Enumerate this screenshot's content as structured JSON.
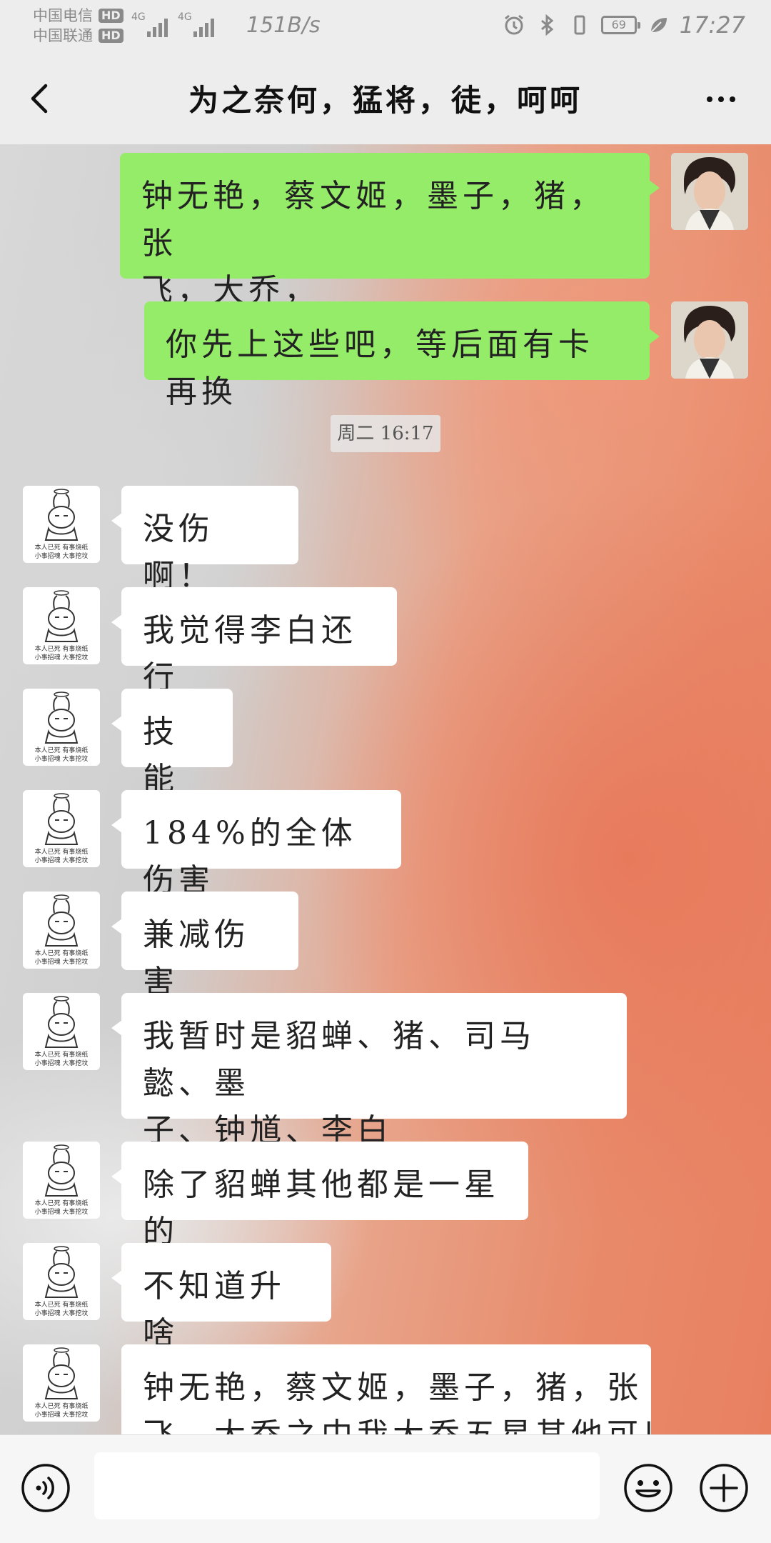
{
  "status_bar": {
    "carrier1": "中国电信",
    "carrier2": "中国联通",
    "hd": "HD",
    "net1": "4G",
    "net2": "4G",
    "speed": "151B/s",
    "battery": "69",
    "time": "17:27"
  },
  "header": {
    "title": "为之奈何，猛将，徒，呵呵"
  },
  "timestamp": "周二 16:17",
  "avatar_caption_line1": "本人已死 有事烧纸",
  "avatar_caption_line2": "小事招魂 大事挖坟",
  "messages_out": [
    {
      "line1": "钟无艳，蔡文姬，墨子，猪，张",
      "line2": "飞，大乔，"
    },
    {
      "line1": "你先上这些吧，等后面有卡再换"
    }
  ],
  "messages_in": [
    {
      "line1": "没伤啊！"
    },
    {
      "line1": "我觉得李白还行"
    },
    {
      "line1": "技能"
    },
    {
      "line1": "184%的全体伤害"
    },
    {
      "line1": "兼减伤害"
    },
    {
      "line1": "我暂时是貂蝉、猪、司马懿、墨",
      "line2": "子、钟馗、李白"
    },
    {
      "line1": "除了貂蝉其他都是一星的"
    },
    {
      "line1": "不知道升啥"
    },
    {
      "line1": "钟无艳，蔡文姬，墨子，猪，张",
      "line2": "飞，大乔之中我大乔五星其他可以"
    }
  ]
}
